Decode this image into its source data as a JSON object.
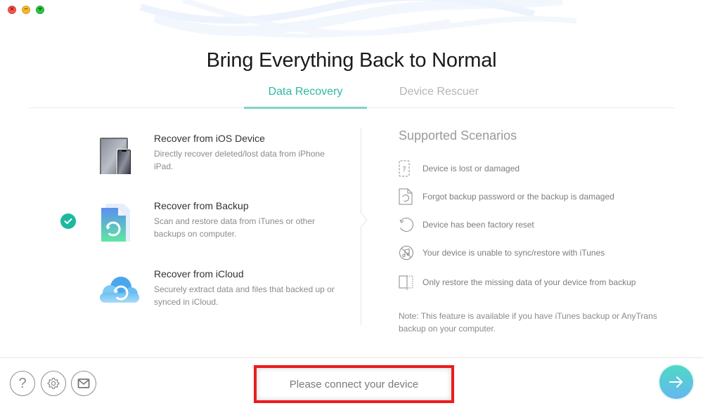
{
  "window": {
    "traffic_lights": [
      {
        "name": "close",
        "glyph": "×",
        "color": "#ee5a52"
      },
      {
        "name": "minimize",
        "glyph": "−",
        "color": "#f5b82e"
      },
      {
        "name": "maximize",
        "glyph": "+",
        "color": "#2bc440"
      }
    ]
  },
  "header": {
    "title": "Bring Everything Back to Normal"
  },
  "tabs": [
    {
      "label": "Data Recovery",
      "active": true
    },
    {
      "label": "Device Rescuer",
      "active": false
    }
  ],
  "options": [
    {
      "title": "Recover from iOS Device",
      "description": "Directly recover deleted/lost data from iPhone iPad.",
      "icon": "ios-device-icon",
      "selected": false
    },
    {
      "title": "Recover from Backup",
      "description": "Scan and restore data from iTunes or other backups on computer.",
      "icon": "backup-file-icon",
      "selected": true
    },
    {
      "title": "Recover from iCloud",
      "description": "Securely extract data and files that backed up or synced in iCloud.",
      "icon": "icloud-icon",
      "selected": false
    }
  ],
  "scenarios": {
    "title": "Supported Scenarios",
    "items": [
      {
        "text": "Device is lost or damaged",
        "icon": "device-question-icon"
      },
      {
        "text": "Forgot backup password or the backup is damaged",
        "icon": "backup-restore-file-icon"
      },
      {
        "text": "Device has been factory reset",
        "icon": "reset-arrow-icon"
      },
      {
        "text": "Your device is unable to sync/restore with iTunes",
        "icon": "itunes-blocked-icon"
      },
      {
        "text": "Only restore the missing data of your device from backup",
        "icon": "partial-restore-icon"
      }
    ],
    "note": "Note: This feature is available if you have iTunes backup or AnyTrans backup on your computer."
  },
  "footer": {
    "help_glyph": "?",
    "status": "Please connect your device",
    "accent": "#2fb8a4",
    "highlight_color": "#ec1c1c"
  }
}
